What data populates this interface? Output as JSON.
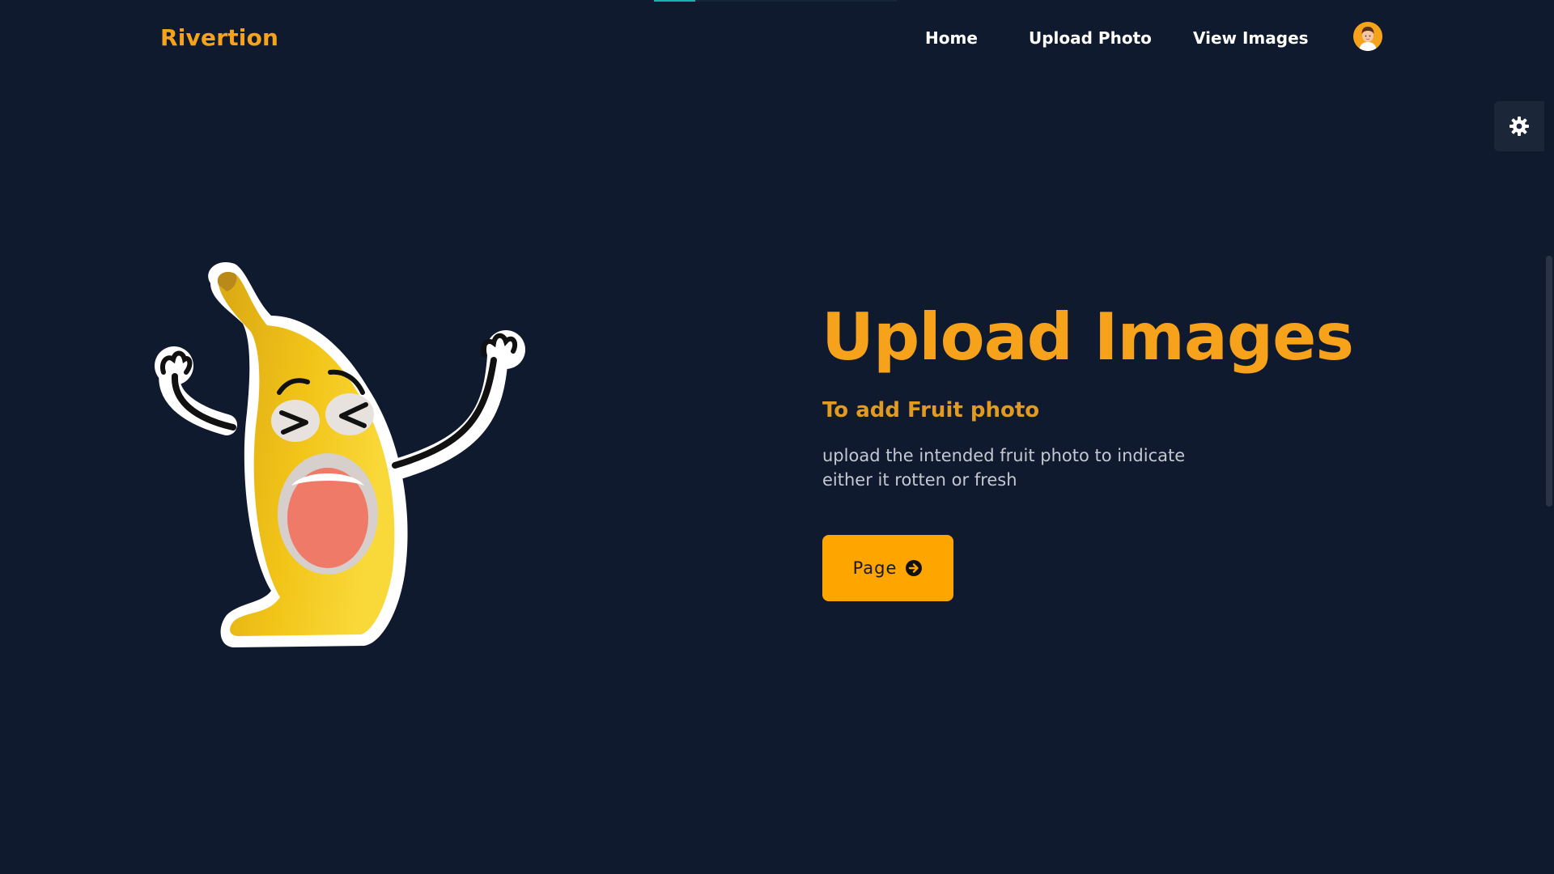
{
  "colors": {
    "background": "#0f1a2e",
    "accent": "#f6a21b",
    "subtitle": "#e19a22",
    "button": "#ffa500",
    "text_muted": "#c3c8d2",
    "progress": "#17b3b0"
  },
  "top_progress": {
    "fraction": 0.17
  },
  "header": {
    "logo": "Rivertion",
    "nav": {
      "home": "Home",
      "upload_photo": "Upload Photo",
      "view_images": "View Images"
    },
    "avatar_icon": "user-avatar"
  },
  "settings": {
    "icon": "gear-icon"
  },
  "hero": {
    "image_icon": "screaming-banana-sticker",
    "title": "Upload Images",
    "subtitle": "To add Fruit photo",
    "description": "upload the intended fruit photo to indicate either it rotten or fresh",
    "button_label": "Page",
    "button_icon": "arrow-circle-right-icon"
  }
}
